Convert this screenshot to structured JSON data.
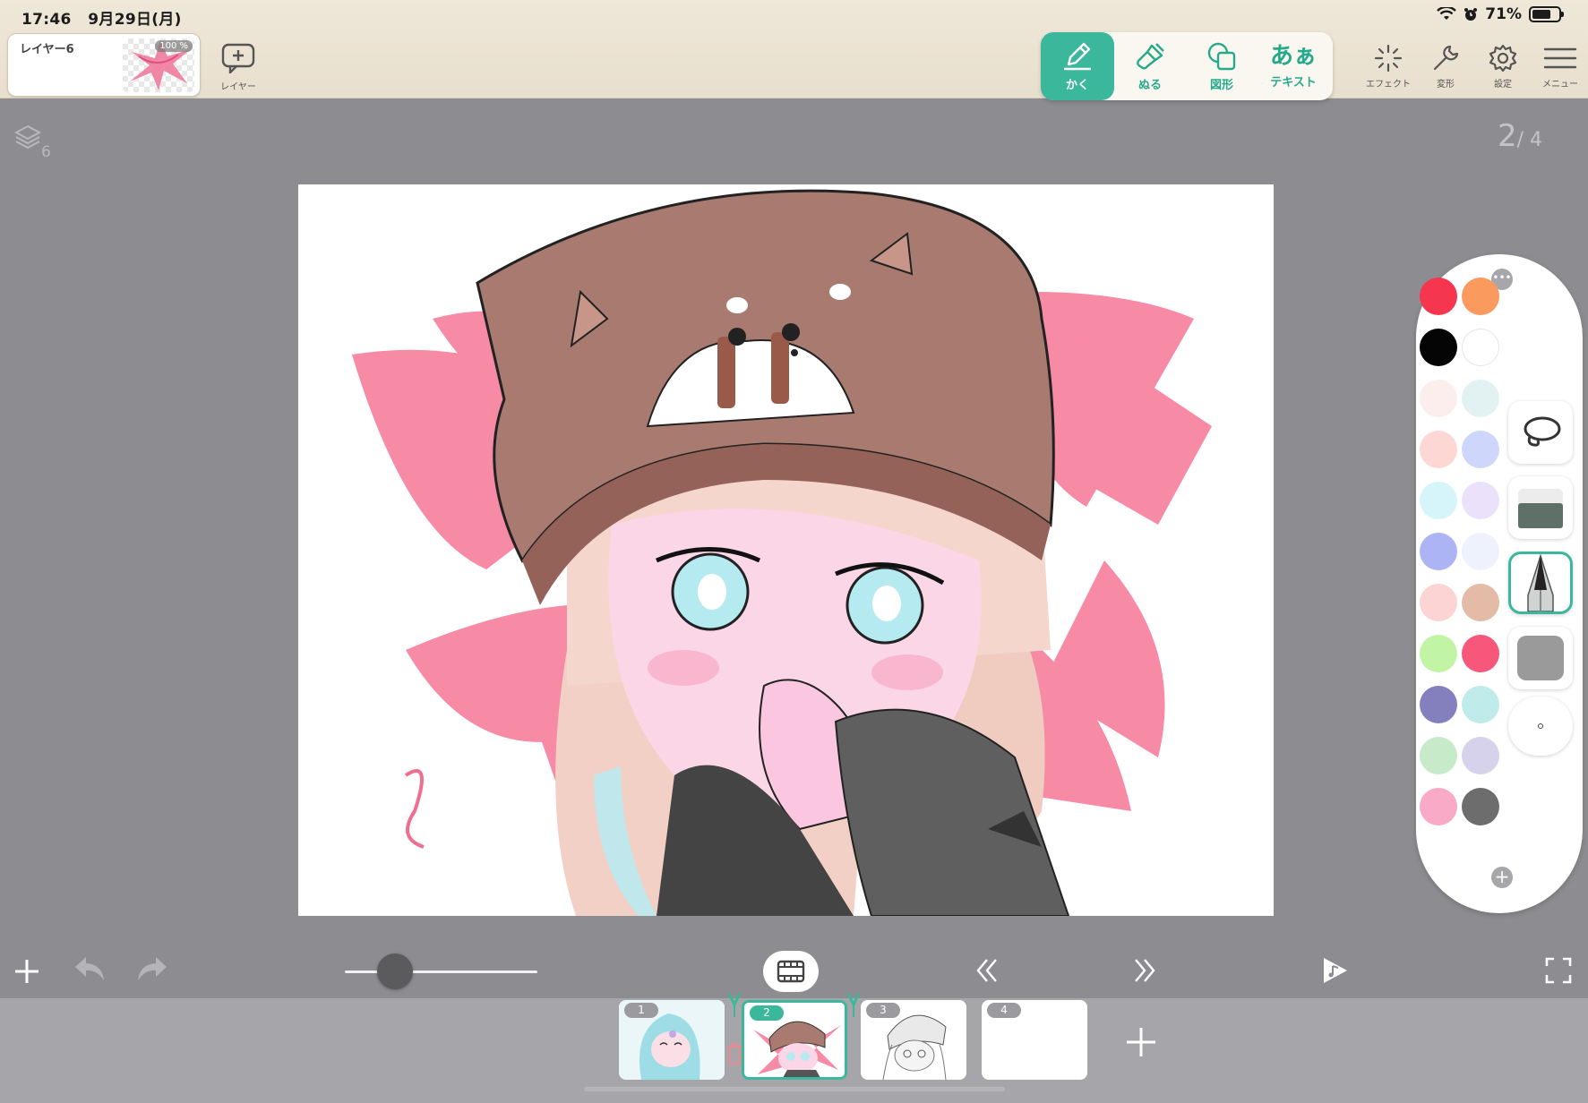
{
  "status": {
    "time": "17:46",
    "date": "9月29日(月)",
    "battery": "71%",
    "battery_level": 0.71,
    "icons": [
      "wifi-icon",
      "alarm-icon",
      "battery-icon"
    ]
  },
  "layer_panel": {
    "name": "レイヤー6",
    "opacity": "100 %",
    "add_label": "レイヤー"
  },
  "tools": [
    {
      "id": "draw",
      "label": "かく",
      "icon": "pen-icon",
      "active": true
    },
    {
      "id": "fill",
      "label": "ぬる",
      "icon": "brush-icon",
      "active": false
    },
    {
      "id": "shape",
      "label": "図形",
      "icon": "shape-icon",
      "active": false
    },
    {
      "id": "text",
      "label": "テキスト",
      "icon": "text-icon",
      "glyph": "あぁ",
      "active": false
    }
  ],
  "right_tools": [
    {
      "id": "effect",
      "label": "エフェクト",
      "icon": "sparkle-icon"
    },
    {
      "id": "transform",
      "label": "変形",
      "icon": "wrench-icon"
    },
    {
      "id": "settings",
      "label": "設定",
      "icon": "gear-icon"
    },
    {
      "id": "menu",
      "label": "メニュー",
      "icon": "hamburger-icon"
    }
  ],
  "layers_count": "6",
  "page": {
    "current": "2",
    "total": "/ 4"
  },
  "palette": {
    "colors": [
      [
        "#f6354f",
        "#fb9a5e"
      ],
      [
        "#050505",
        "#ffffff"
      ],
      [
        "#fdeeee",
        "#e2f1f2"
      ],
      [
        "#fdd7d3",
        "#cfd6fb"
      ],
      [
        "#d6f5fb",
        "#ece1fb"
      ],
      [
        "#adb4f6",
        "#eef2fd"
      ],
      [
        "#fbd4d3",
        "#e3bba7"
      ],
      [
        "#c2f4a6",
        "#f6577a"
      ],
      [
        "#8480be",
        "#bfebea"
      ],
      [
        "#c7ebc8",
        "#d7d2ec"
      ],
      [
        "#f9aac7",
        "#6d6d6d"
      ]
    ],
    "brushes": [
      "lasso-icon",
      "eraser-icon",
      "pen-nib-icon",
      "gray-swatch",
      "brush-size-dot"
    ],
    "selected_brush": 2
  },
  "controls": {
    "zoom_value": 0.26,
    "icons": [
      "add-icon",
      "undo-icon",
      "redo-icon",
      "film-icon",
      "prev-frame-icon",
      "next-frame-icon",
      "play-icon",
      "fullscreen-icon"
    ]
  },
  "frames": [
    {
      "num": "1",
      "selected": false
    },
    {
      "num": "2",
      "selected": true
    },
    {
      "num": "3",
      "selected": false
    },
    {
      "num": "4",
      "selected": false
    }
  ]
}
